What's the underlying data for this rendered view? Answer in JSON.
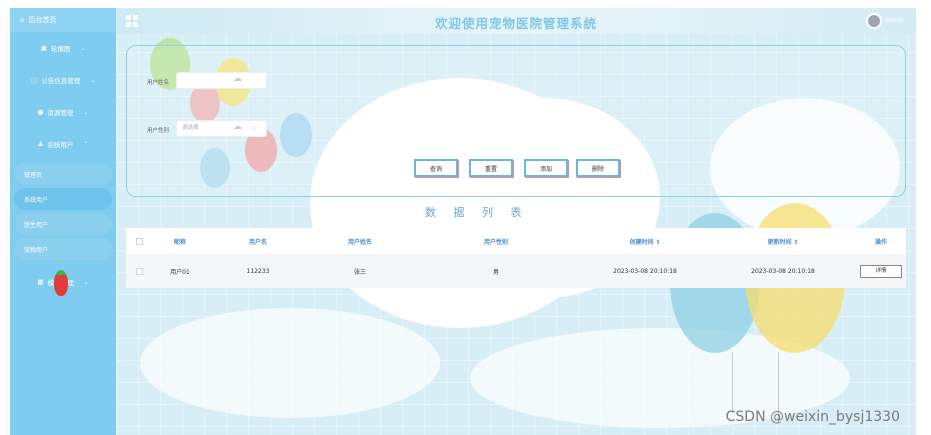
{
  "header": {
    "title": "欢迎使用宠物医院管理系统",
    "user": "admin"
  },
  "sidebar": {
    "top": "后台首页",
    "items": [
      {
        "label": "轮播图"
      },
      {
        "label": "公告信息管理"
      },
      {
        "label": "资源管理"
      },
      {
        "label": "系统用户"
      }
    ],
    "subitems": [
      {
        "label": "管理员"
      },
      {
        "label": "系统用户"
      },
      {
        "label": "医生用户"
      },
      {
        "label": "宠物用户"
      }
    ],
    "last": "模块管理"
  },
  "search": {
    "name_label": "用户姓名",
    "gender_label": "用户性别",
    "gender_placeholder": "请选择",
    "buttons": {
      "query": "查询",
      "reset": "重置",
      "add": "添加",
      "delete": "删除"
    }
  },
  "list_title": "数 据 列 表",
  "table": {
    "headers": [
      "昵称",
      "用户名",
      "用户姓名",
      "用户性别",
      "创建时间 ⇕",
      "更新时间 ⇕",
      "操作"
    ],
    "rows": [
      {
        "nickname": "用户01",
        "username": "112233",
        "name": "张三",
        "gender": "男",
        "created": "2023-03-08 20:10:18",
        "updated": "2023-03-08 20:10:18",
        "action": "详情"
      }
    ]
  },
  "watermark": "CSDN @weixin_bysj1330"
}
